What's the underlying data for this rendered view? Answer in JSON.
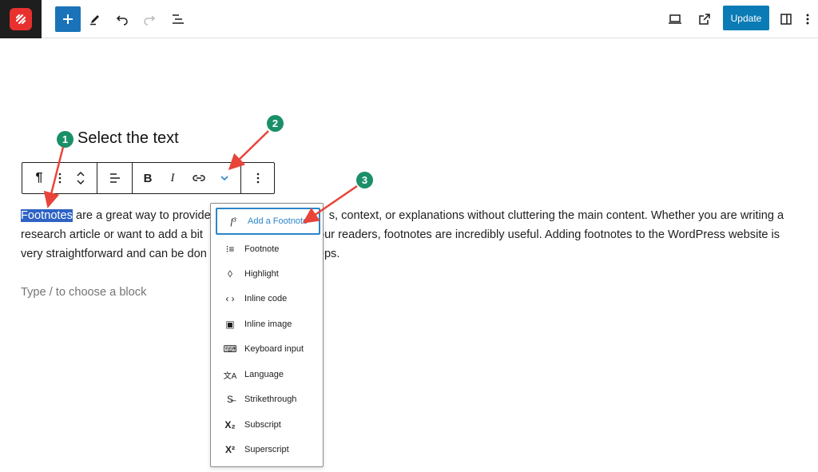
{
  "topbar": {
    "update_label": "Update",
    "icons": [
      "wordpress-logo-icon",
      "plus-icon",
      "pencil-icon",
      "undo-icon",
      "redo-icon",
      "list-view-icon",
      "desktop-preview-icon",
      "external-link-icon",
      "sidebar-toggle-icon",
      "more-vertical-icon"
    ]
  },
  "annotations": {
    "step1": "1",
    "step2": "2",
    "step3": "3",
    "label1": "Select the text"
  },
  "block_toolbar": {
    "icons": [
      "paragraph-icon",
      "drag-handle-icon",
      "move-up-down-icon",
      "align-icon",
      "bold-icon",
      "italic-icon",
      "link-icon",
      "chevron-down-icon",
      "more-options-icon"
    ]
  },
  "content": {
    "selected_word": "Footnotes",
    "line1_rest": " are a great way to provide",
    "line1_tail": "s, context, or explanations without cluttering the main content. Whether you are writing a",
    "line2_head": "research article or want to add a bit",
    "line2_tail": "our readers, footnotes are incredibly useful. Adding footnotes to the WordPress website is",
    "line3_head": "very straightforward and can be don",
    "line3_tail": "eps.",
    "placeholder": "Type / to choose a block"
  },
  "dropdown": {
    "items": [
      {
        "label": "Add a Footnote",
        "icon": "f³"
      },
      {
        "label": "Footnote",
        "icon": "⁝≡"
      },
      {
        "label": "Highlight",
        "icon": "◊"
      },
      {
        "label": "Inline code",
        "icon": "‹ ›"
      },
      {
        "label": "Inline image",
        "icon": "▣"
      },
      {
        "label": "Keyboard input",
        "icon": "⌨"
      },
      {
        "label": "Language",
        "icon": "文A"
      },
      {
        "label": "Strikethrough",
        "icon": "S̶"
      },
      {
        "label": "Subscript",
        "icon": "X₂"
      },
      {
        "label": "Superscript",
        "icon": "X²"
      }
    ]
  },
  "colors": {
    "accent": "#0a7bb5",
    "selection": "#2e62c4",
    "annotation": "#1a8f6a",
    "arrow": "#e8443a"
  }
}
